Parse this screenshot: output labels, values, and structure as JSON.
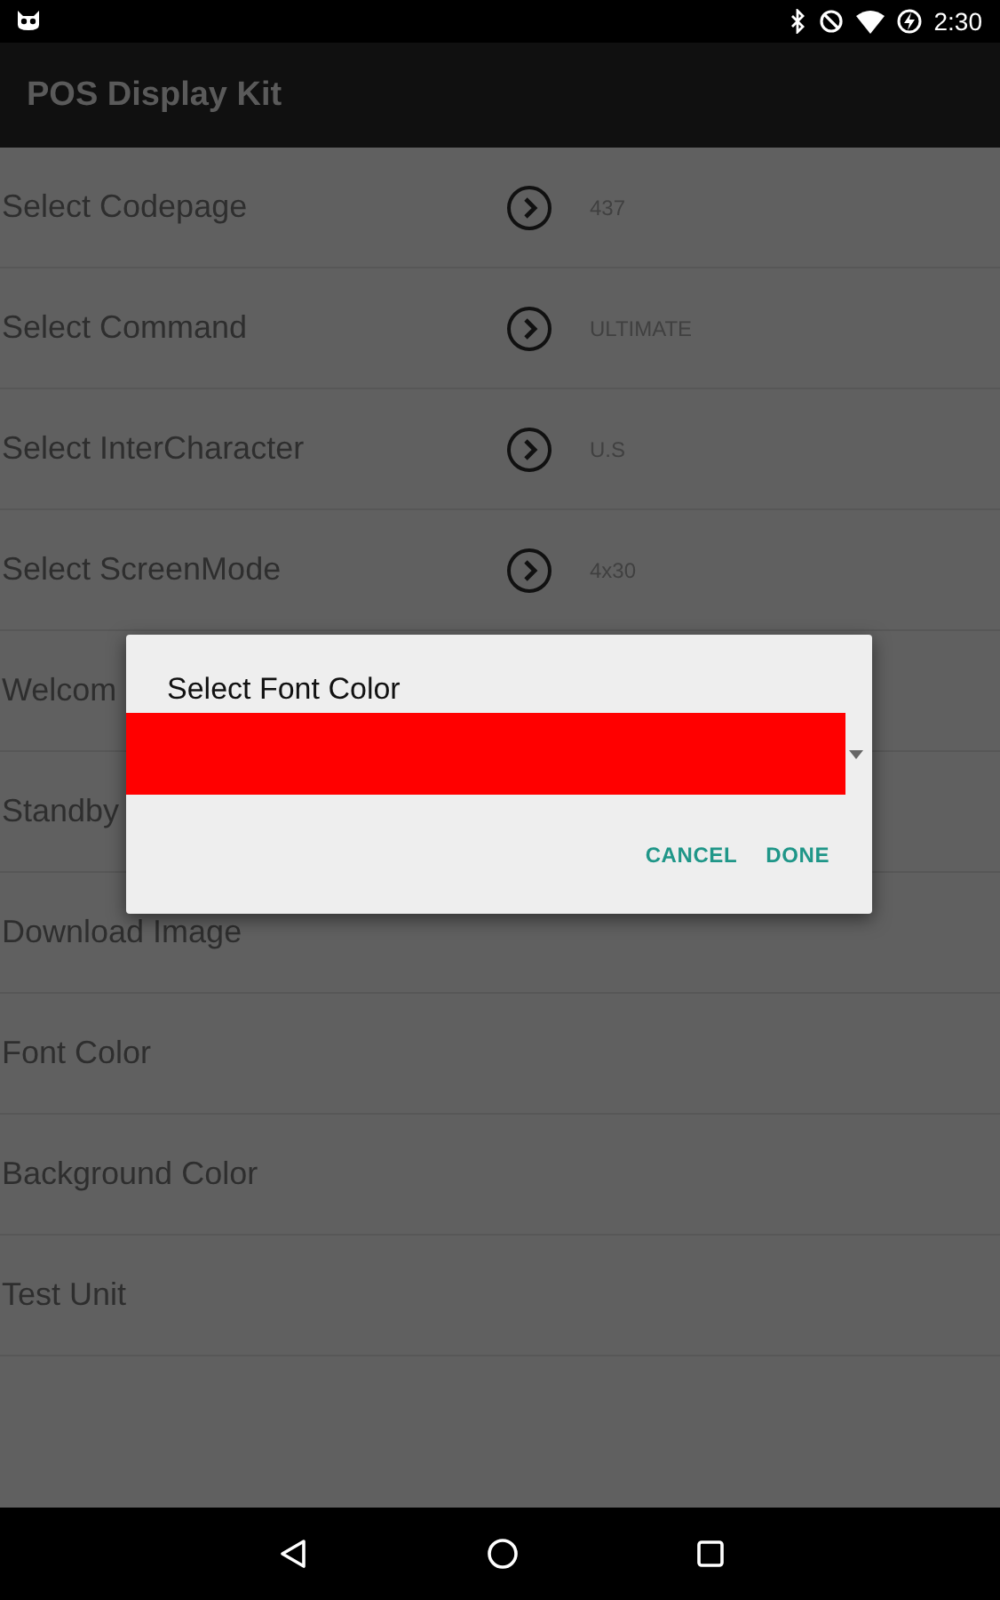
{
  "status_bar": {
    "time": "2:30"
  },
  "app_bar": {
    "title": "POS Display Kit"
  },
  "settings": [
    {
      "kind": "option",
      "label": "Select Codepage",
      "value": "437"
    },
    {
      "kind": "option",
      "label": "Select Command",
      "value": "ULTIMATE"
    },
    {
      "kind": "option",
      "label": "Select InterCharacter",
      "value": "U.S"
    },
    {
      "kind": "option",
      "label": "Select ScreenMode",
      "value": "4x30"
    },
    {
      "kind": "plain",
      "label": "Welcom"
    },
    {
      "kind": "plain",
      "label": "Standby"
    },
    {
      "kind": "plain",
      "label": "Download Image"
    },
    {
      "kind": "plain",
      "label": "Font Color"
    },
    {
      "kind": "plain",
      "label": "Background Color"
    },
    {
      "kind": "plain",
      "label": "Test Unit"
    }
  ],
  "dialog": {
    "title": "Select Font Color",
    "spinner": {
      "color": "#ff0000"
    },
    "buttons": [
      "CANCEL",
      "DONE"
    ]
  }
}
